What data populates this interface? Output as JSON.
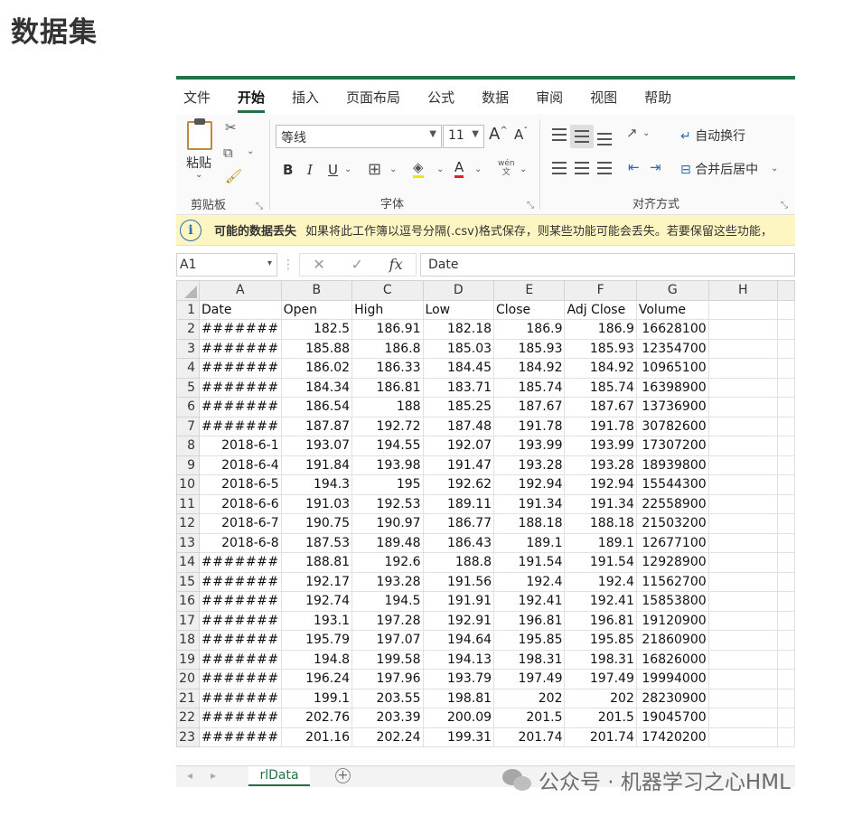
{
  "page_title": "数据集",
  "excel": {
    "tabs": [
      "文件",
      "开始",
      "插入",
      "页面布局",
      "公式",
      "数据",
      "审阅",
      "视图",
      "帮助"
    ],
    "active_tab": "开始",
    "ribbon": {
      "clipboard": {
        "paste_label": "粘贴",
        "group_label": "剪贴板"
      },
      "font": {
        "font_name": "等线",
        "font_size": "11",
        "group_label": "字体",
        "bold": "B",
        "italic": "I",
        "underline": "U",
        "grow": "A",
        "shrink": "A",
        "pinyin": "wén"
      },
      "alignment": {
        "wrap_text": "自动换行",
        "merge_center": "合并后居中",
        "group_label": "对齐方式"
      }
    },
    "warning": {
      "title": "可能的数据丢失",
      "message": "如果将此工作簿以逗号分隔(.csv)格式保存，则某些功能可能会丢失。若要保留这些功能，"
    },
    "formula_bar": {
      "name_box": "A1",
      "content": "Date",
      "fx": "fx"
    },
    "columns": [
      "A",
      "B",
      "C",
      "D",
      "E",
      "F",
      "G",
      "H"
    ],
    "header_row": [
      "Date",
      "Open",
      "High",
      "Low",
      "Close",
      "Adj Close",
      "Volume"
    ],
    "rows": [
      [
        "#######",
        "182.5",
        "186.91",
        "182.18",
        "186.9",
        "186.9",
        "16628100"
      ],
      [
        "#######",
        "185.88",
        "186.8",
        "185.03",
        "185.93",
        "185.93",
        "12354700"
      ],
      [
        "#######",
        "186.02",
        "186.33",
        "184.45",
        "184.92",
        "184.92",
        "10965100"
      ],
      [
        "#######",
        "184.34",
        "186.81",
        "183.71",
        "185.74",
        "185.74",
        "16398900"
      ],
      [
        "#######",
        "186.54",
        "188",
        "185.25",
        "187.67",
        "187.67",
        "13736900"
      ],
      [
        "#######",
        "187.87",
        "192.72",
        "187.48",
        "191.78",
        "191.78",
        "30782600"
      ],
      [
        "2018-6-1",
        "193.07",
        "194.55",
        "192.07",
        "193.99",
        "193.99",
        "17307200"
      ],
      [
        "2018-6-4",
        "191.84",
        "193.98",
        "191.47",
        "193.28",
        "193.28",
        "18939800"
      ],
      [
        "2018-6-5",
        "194.3",
        "195",
        "192.62",
        "192.94",
        "192.94",
        "15544300"
      ],
      [
        "2018-6-6",
        "191.03",
        "192.53",
        "189.11",
        "191.34",
        "191.34",
        "22558900"
      ],
      [
        "2018-6-7",
        "190.75",
        "190.97",
        "186.77",
        "188.18",
        "188.18",
        "21503200"
      ],
      [
        "2018-6-8",
        "187.53",
        "189.48",
        "186.43",
        "189.1",
        "189.1",
        "12677100"
      ],
      [
        "#######",
        "188.81",
        "192.6",
        "188.8",
        "191.54",
        "191.54",
        "12928900"
      ],
      [
        "#######",
        "192.17",
        "193.28",
        "191.56",
        "192.4",
        "192.4",
        "11562700"
      ],
      [
        "#######",
        "192.74",
        "194.5",
        "191.91",
        "192.41",
        "192.41",
        "15853800"
      ],
      [
        "#######",
        "193.1",
        "197.28",
        "192.91",
        "196.81",
        "196.81",
        "19120900"
      ],
      [
        "#######",
        "195.79",
        "197.07",
        "194.64",
        "195.85",
        "195.85",
        "21860900"
      ],
      [
        "#######",
        "194.8",
        "199.58",
        "194.13",
        "198.31",
        "198.31",
        "16826000"
      ],
      [
        "#######",
        "196.24",
        "197.96",
        "193.79",
        "197.49",
        "197.49",
        "19994000"
      ],
      [
        "#######",
        "199.1",
        "203.55",
        "198.81",
        "202",
        "202",
        "28230900"
      ],
      [
        "#######",
        "202.76",
        "203.39",
        "200.09",
        "201.5",
        "201.5",
        "19045700"
      ],
      [
        "#######",
        "201.16",
        "202.24",
        "199.31",
        "201.74",
        "201.74",
        "17420200"
      ]
    ],
    "sheet_tab": "rlData",
    "accent_color": "#217346"
  },
  "watermark": "公众号 · 机器学习之心HML"
}
